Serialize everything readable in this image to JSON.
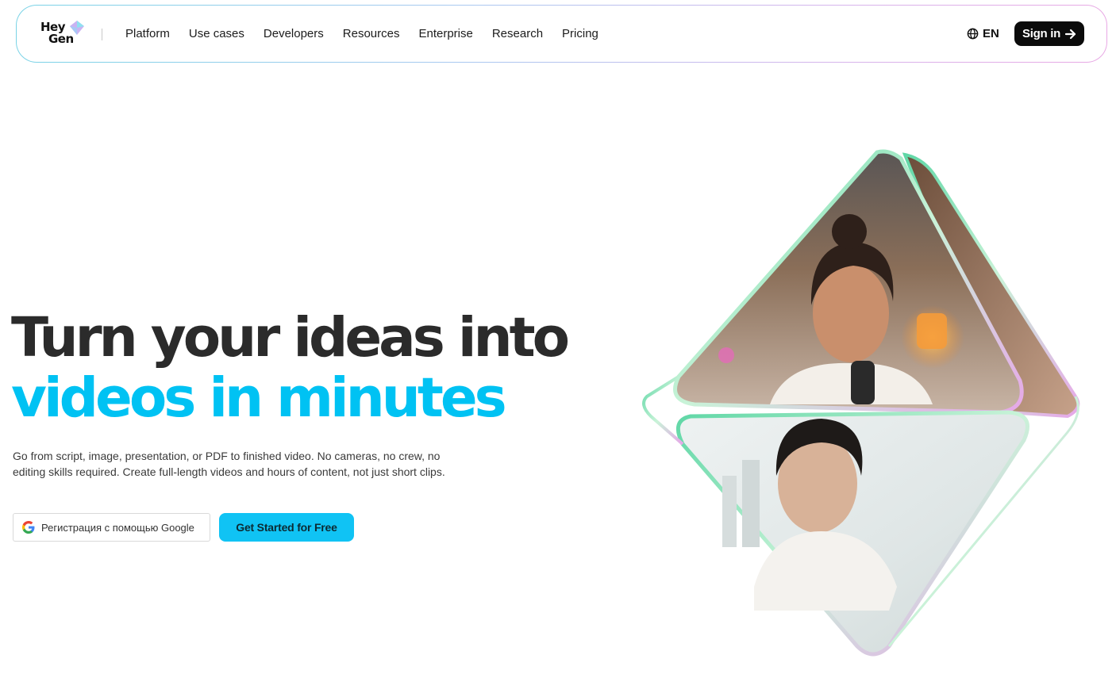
{
  "brand": {
    "logo_line1": "Hey",
    "logo_line2": "Gen"
  },
  "nav": {
    "items": [
      {
        "label": "Platform"
      },
      {
        "label": "Use cases"
      },
      {
        "label": "Developers"
      },
      {
        "label": "Resources"
      },
      {
        "label": "Enterprise"
      },
      {
        "label": "Research"
      },
      {
        "label": "Pricing"
      }
    ],
    "language": "EN",
    "signin_label": "Sign in"
  },
  "hero": {
    "title_line1": "Turn your ideas into",
    "title_line2": "videos in minutes",
    "subtitle": "Go from script, image, presentation, or PDF to finished video. No cameras, no crew, no editing skills required. Create full-length videos and hours of content, not just short clips.",
    "google_button_label": "Регистрация с помощью Google",
    "cta_label": "Get Started for Free"
  },
  "colors": {
    "accent": "#00c2f3",
    "cta_bg": "#10c3f4",
    "title_dark": "#2b2b2b",
    "signin_bg": "#0b0b0b"
  },
  "icons": {
    "globe": "globe-icon",
    "arrow": "arrow-right-icon",
    "google": "google-g-icon",
    "logo_gem": "gem-icon"
  }
}
